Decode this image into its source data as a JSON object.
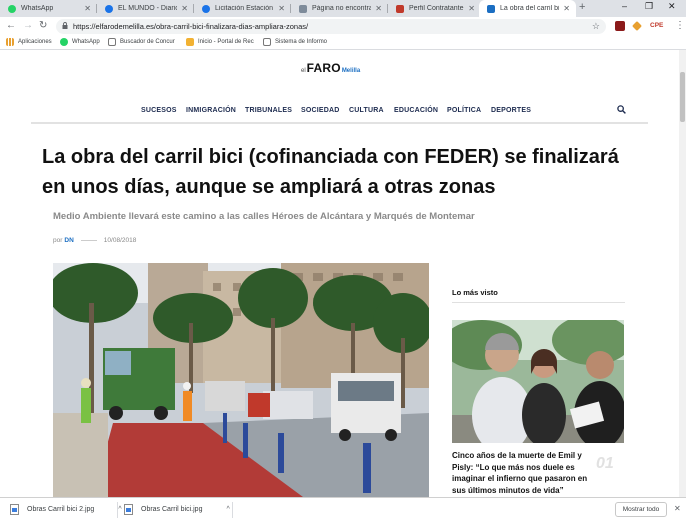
{
  "browser": {
    "tabs": [
      {
        "title": "WhatsApp",
        "color": "#25d366"
      },
      {
        "title": "EL MUNDO - Diario on",
        "color": "#1a73e8"
      },
      {
        "title": "Licitación Estación de",
        "color": "#1a73e8"
      },
      {
        "title": "Página no encontrada",
        "color": "#7e8b9a"
      },
      {
        "title": "Perfil Contratante - Bu",
        "color": "#c0392b"
      },
      {
        "title": "La obra del carril bici",
        "color": "#1b6ec2"
      }
    ],
    "new_tab": "+",
    "window_controls": {
      "minimize": "–",
      "maximize": "❐",
      "close": "✕"
    },
    "toolbar": {
      "back": "←",
      "forward": "→",
      "reload": "↻",
      "lock": "🔒",
      "url": "https://elfarodemelilla.es/obra-carril-bici-finalizara-dias-ampliara-zonas/",
      "star": "☆",
      "ext_label": "CPE",
      "menu": "⋮"
    },
    "bookmarks": [
      {
        "label": "Aplicaciones",
        "color": "#e8a030"
      },
      {
        "label": "WhatsApp",
        "color": "#25d366"
      },
      {
        "label": "Buscador de Concur",
        "color": "#ffffff"
      },
      {
        "label": "Inicio - Portal de Rec",
        "color": "#f2b233"
      },
      {
        "label": "Sistema de Informo",
        "color": "#ffffff"
      }
    ]
  },
  "site": {
    "logo": {
      "pre": "el",
      "main": "FARO",
      "post": "Melilla"
    },
    "nav": [
      "SUCESOS",
      "INMIGRACIÓN",
      "TRIBUNALES",
      "SOCIEDAD",
      "CULTURA",
      "EDUCACIÓN",
      "POLÍTICA",
      "DEPORTES"
    ],
    "search_icon": "⌕"
  },
  "article": {
    "headline_line1": "La obra del carril bici (cofinanciada con FEDER) se finalizará",
    "headline_line2": "en unos días, aunque se ampliará a otras zonas",
    "subtitle": "Medio Ambiente llevará este camino a las calles Héroes de Alcántara y Marqués de Montemar",
    "by_prefix": "por",
    "author": "DN",
    "date": "10/08/2018"
  },
  "sidebar": {
    "heading": "Lo más visto",
    "item_title": "Cinco años de la muerte de Emil y Pisly: “Lo que más nos duele es imaginar el infierno que pasaron en sus últimos minutos de vida”",
    "item_number": "01"
  },
  "downloads": {
    "files": [
      "Obras Carril bici 2.jpg",
      "Obras Carril bici.jpg"
    ],
    "caret": "^",
    "show_all": "Mostrar todo",
    "close": "✕"
  },
  "colors": {
    "brand_blue": "#1b6ec2",
    "nav_text": "#1d2b4f",
    "bike_lane": "#b23b37"
  }
}
